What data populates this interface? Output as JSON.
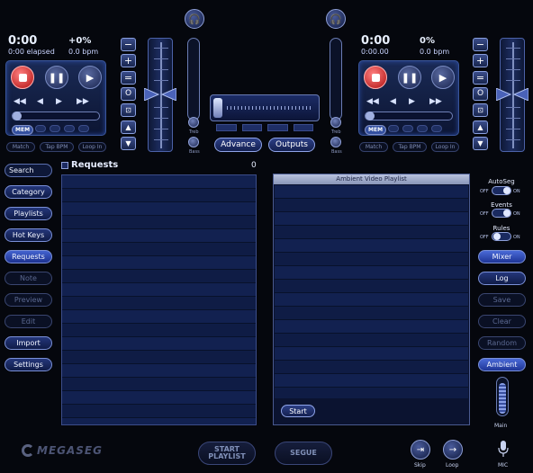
{
  "left_deck": {
    "time": "0:00",
    "elapsed": "0:00 elapsed",
    "pitch": "+0%",
    "bpm": "0.0 bpm"
  },
  "right_deck": {
    "time": "0:00",
    "elapsed": "0:00.00",
    "pitch": "0%",
    "bpm": "0.0 bpm"
  },
  "deck_labels": {
    "mem": "MEM",
    "match": "Match",
    "tap": "Tap BPM",
    "loop": "Loop In"
  },
  "pitch_buttons": {
    "minus": "−",
    "plus": "+",
    "equal": "=",
    "circle": "O",
    "lock": "🔒",
    "up": "▲",
    "down": "▼"
  },
  "mixer": {
    "treb": "Treb",
    "bass": "Bass",
    "advance": "Advance",
    "outputs": "Outputs"
  },
  "sidebar": {
    "items": [
      {
        "label": "Search",
        "state": "active"
      },
      {
        "label": "Category",
        "state": "active"
      },
      {
        "label": "Playlists",
        "state": "active"
      },
      {
        "label": "Hot Keys",
        "state": "active"
      },
      {
        "label": "Requests",
        "state": "selected"
      },
      {
        "label": "Note",
        "state": "dim"
      },
      {
        "label": "Preview",
        "state": "dim"
      },
      {
        "label": "Edit",
        "state": "dim"
      },
      {
        "label": "Import",
        "state": "active"
      },
      {
        "label": "Settings",
        "state": "active"
      }
    ]
  },
  "requests": {
    "title": "Requests",
    "count": "0"
  },
  "playlist": {
    "title": "Ambient Video Playlist",
    "start": "Start"
  },
  "toggles": [
    {
      "label": "AutoSeg",
      "off": "OFF",
      "on": "ON",
      "value": "on"
    },
    {
      "label": "Events",
      "off": "OFF",
      "on": "ON",
      "value": "on"
    },
    {
      "label": "Rules",
      "off": "OFF",
      "on": "ON",
      "value": "off"
    }
  ],
  "right_buttons": [
    {
      "label": "Mixer",
      "state": "hi"
    },
    {
      "label": "Log",
      "state": "active"
    },
    {
      "label": "Save",
      "state": "dim"
    },
    {
      "label": "Clear",
      "state": "dim"
    },
    {
      "label": "Random",
      "state": "dim"
    },
    {
      "label": "Ambient",
      "state": "hi"
    }
  ],
  "main_volume": {
    "label": "Main"
  },
  "bottom": {
    "logo": "MEGASEG",
    "start_playlist_1": "START",
    "start_playlist_2": "PLAYLIST",
    "segue": "SEGUE",
    "skip": "Skip",
    "loop": "Loop",
    "mic": "MIC"
  },
  "colors": {
    "bg": "#05070d",
    "accent": "#3a5ad0",
    "stop": "#d02020"
  }
}
